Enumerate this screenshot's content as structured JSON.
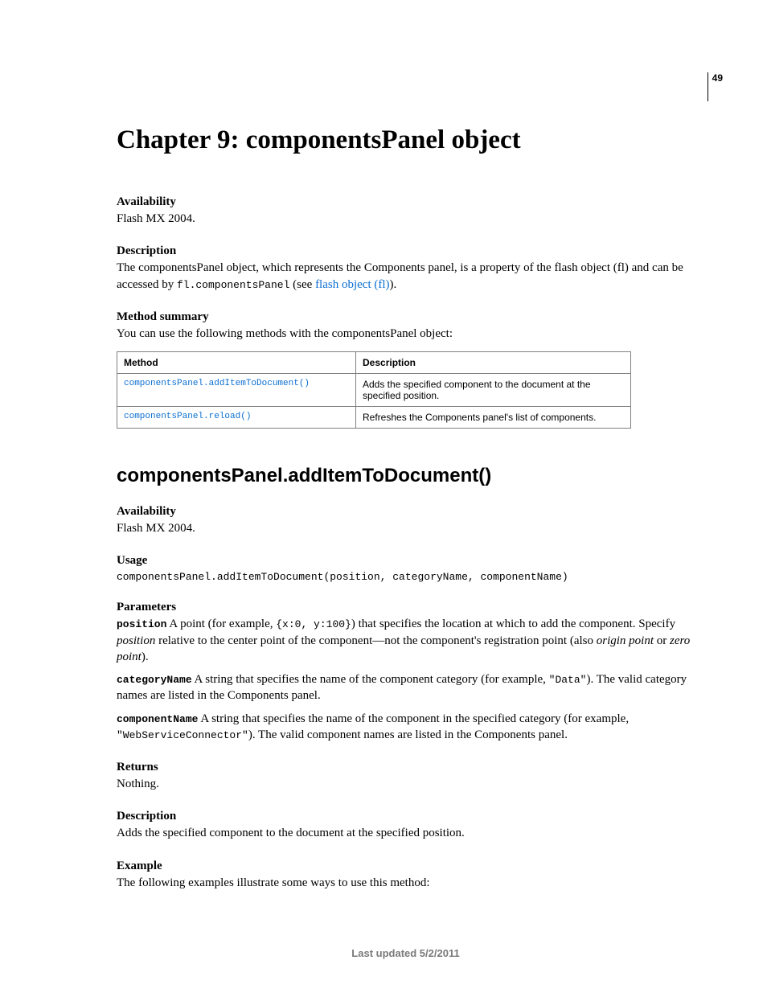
{
  "page_number": "49",
  "chapter_title": "Chapter 9: componentsPanel object",
  "intro": {
    "availability_head": "Availability",
    "availability_body": "Flash MX 2004.",
    "description_head": "Description",
    "description_body_1": "The componentsPanel object, which represents the Components panel, is a property of the flash object (fl) and can be accessed by ",
    "description_code": "fl.componentsPanel",
    "description_body_2": " (see ",
    "description_link": "flash object (fl)",
    "description_body_3": ").",
    "method_summary_head": "Method summary",
    "method_summary_body": "You can use the following methods with the componentsPanel object:"
  },
  "table": {
    "col1": "Method",
    "col2": "Description",
    "rows": [
      {
        "method": "componentsPanel.addItemToDocument()",
        "desc": "Adds the specified component to the document at the specified position."
      },
      {
        "method": "componentsPanel.reload()",
        "desc": "Refreshes the Components panel's list of components."
      }
    ]
  },
  "method": {
    "title": "componentsPanel.addItemToDocument()",
    "availability_head": "Availability",
    "availability_body": "Flash MX 2004.",
    "usage_head": "Usage",
    "usage_code": "componentsPanel.addItemToDocument(position, categoryName, componentName)",
    "parameters_head": "Parameters",
    "param_position_name": "position",
    "param_position_1": "  A point (for example, ",
    "param_position_code": "{x:0, y:100}",
    "param_position_2": ") that specifies the location at which to add the component. Specify ",
    "param_position_italic1": "position",
    "param_position_3": " relative to the center point of the component—not the component's registration point (also ",
    "param_position_italic2": "origin point",
    "param_position_4": " or ",
    "param_position_italic3": "zero point",
    "param_position_5": ").",
    "param_category_name": "categoryName",
    "param_category_1": "  A string that specifies the name of the component category (for example, ",
    "param_category_code": "\"Data\"",
    "param_category_2": "). The valid category names are listed in the Components panel.",
    "param_component_name": "componentName",
    "param_component_1": "  A string that specifies the name of the component in the specified category (for example, ",
    "param_component_code": "\"WebServiceConnector\"",
    "param_component_2": "). The valid component names are listed in the Components panel.",
    "returns_head": "Returns",
    "returns_body": "Nothing.",
    "description_head": "Description",
    "description_body": "Adds the specified component to the document at the specified position.",
    "example_head": "Example",
    "example_body": "The following examples illustrate some ways to use this method:"
  },
  "footer": "Last updated 5/2/2011"
}
